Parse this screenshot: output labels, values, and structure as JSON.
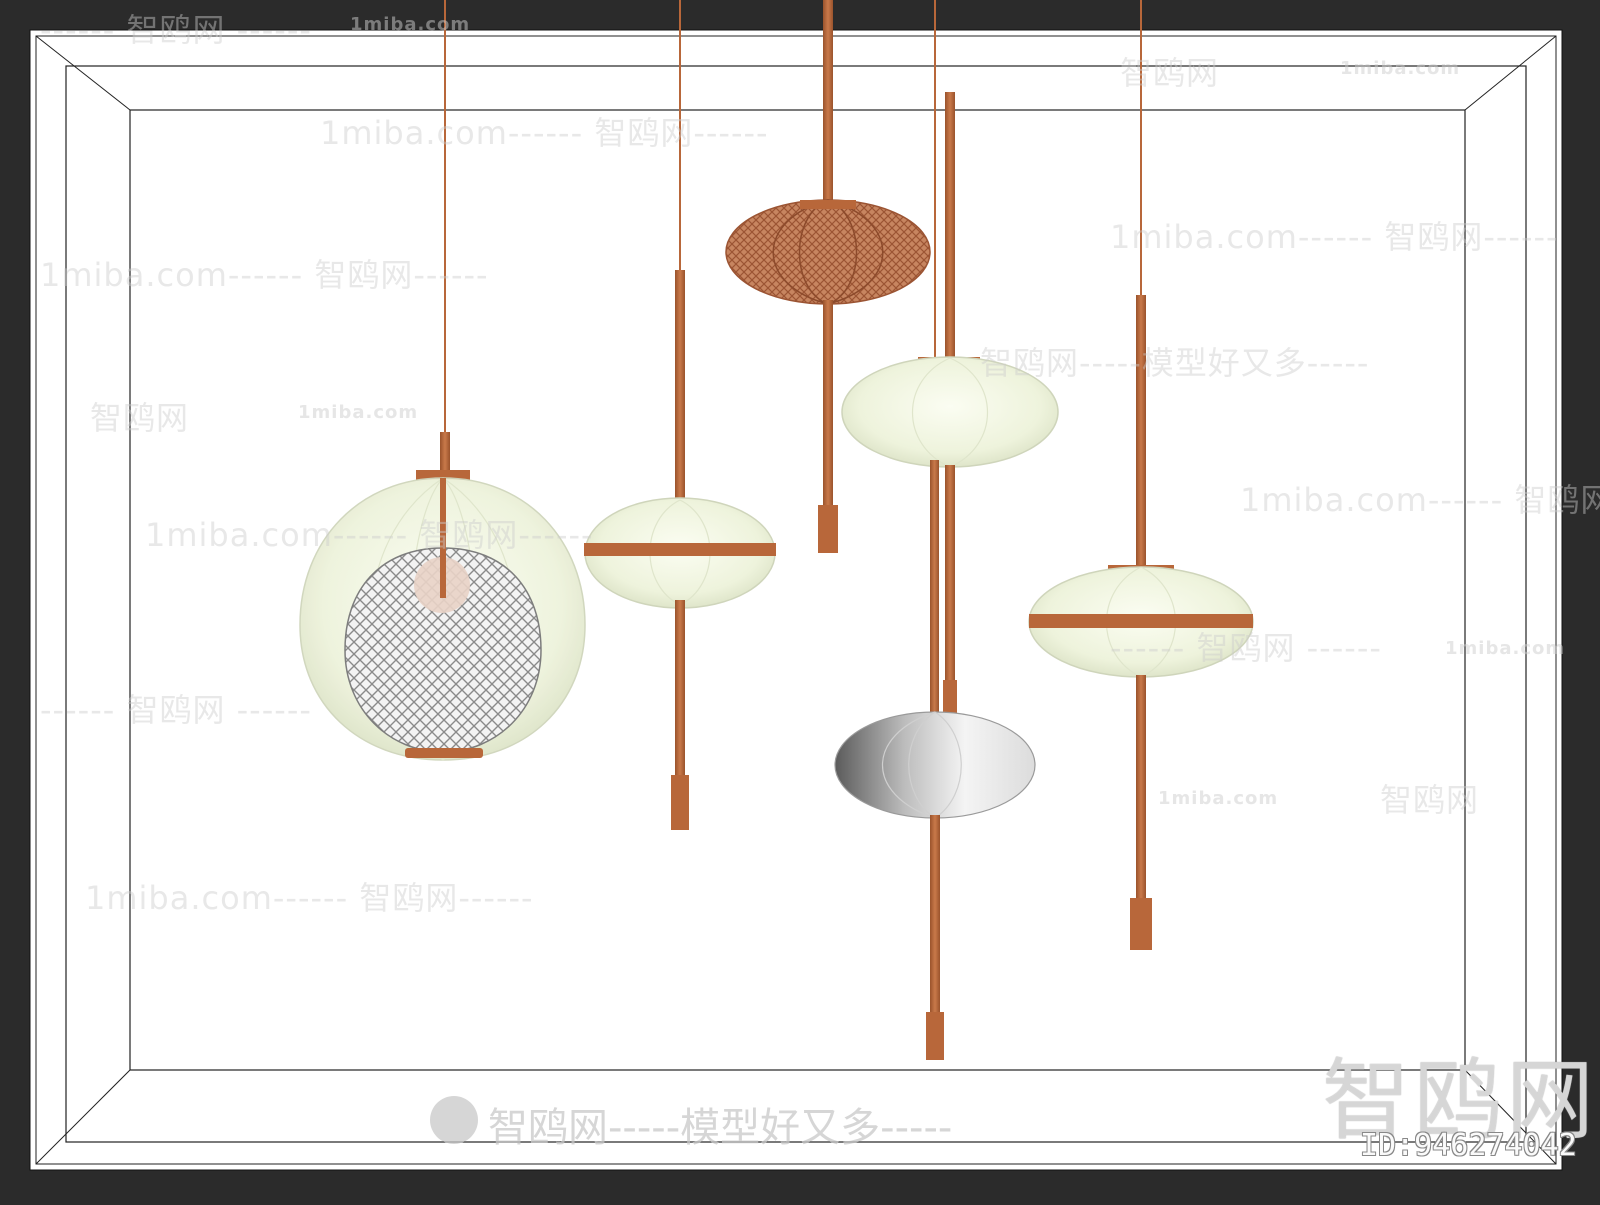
{
  "watermarks": {
    "site_cn": "智鸥网",
    "site_en": "1miba.com",
    "slogan": "智鸥网-----模型好又多-----",
    "slogan_top": "智鸥网-----模型好又多-----",
    "dash_cn": "------ 智鸥网 ------",
    "dash_en": "1miba.com------ 智鸥网------"
  },
  "brand_big": "智鸥网",
  "id_label": "ID:946274042",
  "colors": {
    "background": "#2b2b2b",
    "canvas": "#ffffff",
    "copper": "#b8673a",
    "copper_dark": "#8f4a26",
    "glass": "#eef3dc",
    "rattan": "#c07a52"
  }
}
